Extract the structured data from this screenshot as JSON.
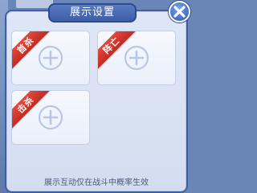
{
  "dialog": {
    "title": "展示设置",
    "close_icon": "close-icon",
    "footer": "展示互动仅在战斗中概率生效"
  },
  "slots": [
    {
      "tag": "首杀",
      "icon": "plus-icon"
    },
    {
      "tag": "阵亡",
      "icon": "plus-icon"
    },
    {
      "tag": "击杀",
      "icon": "plus-icon"
    }
  ],
  "colors": {
    "panel_border": "#3f5fa3",
    "title_bg": "#4a6bb5",
    "ribbon": "#d63a2e",
    "plus": "#b9c7e3"
  }
}
